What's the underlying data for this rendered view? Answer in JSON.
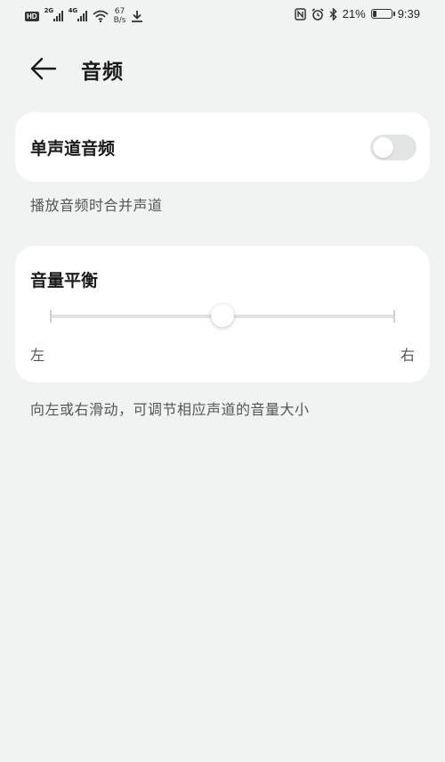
{
  "status_bar": {
    "hd": "HD",
    "sim1": "2G",
    "sim2": "4G",
    "speed_value": "67",
    "speed_unit": "B/s",
    "battery_percent": "21%",
    "battery_level": 0.21,
    "time": "9:39",
    "icons": [
      "hd-icon",
      "signal-icon",
      "wifi-icon",
      "download-icon",
      "nfc-icon",
      "alarm-icon",
      "bluetooth-icon",
      "battery-icon"
    ]
  },
  "header": {
    "title": "音频",
    "back_icon": "back-arrow-icon"
  },
  "mono_audio": {
    "label": "单声道音频",
    "enabled": false,
    "description": "播放音频时合并声道"
  },
  "balance": {
    "label": "音量平衡",
    "left_label": "左",
    "right_label": "右",
    "value": 0.5,
    "description": "向左或右滑动，可调节相应声道的音量大小"
  },
  "colors": {
    "background": "#f1f3f2",
    "card": "#ffffff",
    "toggle_off": "#e3e4e4",
    "track": "#e2e2e2"
  }
}
